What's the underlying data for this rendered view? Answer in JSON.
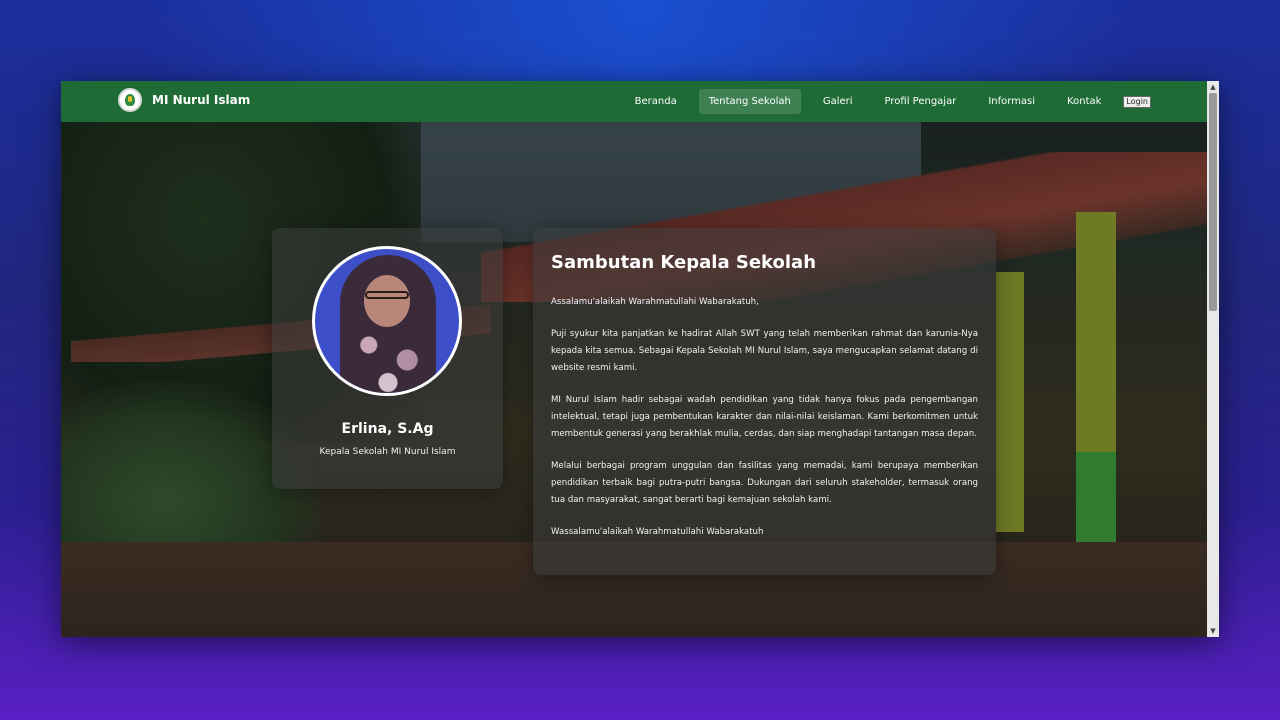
{
  "brand": {
    "name": "MI Nurul Islam"
  },
  "nav": {
    "items": [
      {
        "label": "Beranda"
      },
      {
        "label": "Tentang Sekolah"
      },
      {
        "label": "Galeri"
      },
      {
        "label": "Profil Pengajar"
      },
      {
        "label": "Informasi"
      },
      {
        "label": "Kontak"
      }
    ],
    "active": "Tentang Sekolah",
    "login_label": "Login"
  },
  "profile": {
    "name": "Erlina, S.Ag",
    "role": "Kepala Sekolah MI Nurul Islam"
  },
  "speech": {
    "title": "Sambutan Kepala Sekolah",
    "paragraphs": [
      "Assalamu'alaikah Warahmatullahi Wabarakatuh,",
      "Puji syukur kita panjatkan ke hadirat Allah SWT yang telah memberikan rahmat dan karunia-Nya kepada kita semua. Sebagai Kepala Sekolah MI Nurul Islam, saya mengucapkan selamat datang di website resmi kami.",
      "MI Nurul Islam hadir sebagai wadah pendidikan yang tidak hanya fokus pada pengembangan intelektual, tetapi juga pembentukan karakter dan nilai-nilai keislaman. Kami berkomitmen untuk membentuk generasi yang berakhlak mulia, cerdas, dan siap menghadapi tantangan masa depan.",
      "Melalui berbagai program unggulan dan fasilitas yang memadai, kami berupaya memberikan pendidikan terbaik bagi putra-putri bangsa. Dukungan dari seluruh stakeholder, termasuk orang tua dan masyarakat, sangat berarti bagi kemajuan sekolah kami.",
      "Wassalamu'alaikah Warahmatullahi Wabarakatuh"
    ]
  },
  "colors": {
    "navbar": "#1e6b36",
    "desktop_top": "#1b2f9e",
    "desktop_bottom": "#5a1fc4"
  }
}
